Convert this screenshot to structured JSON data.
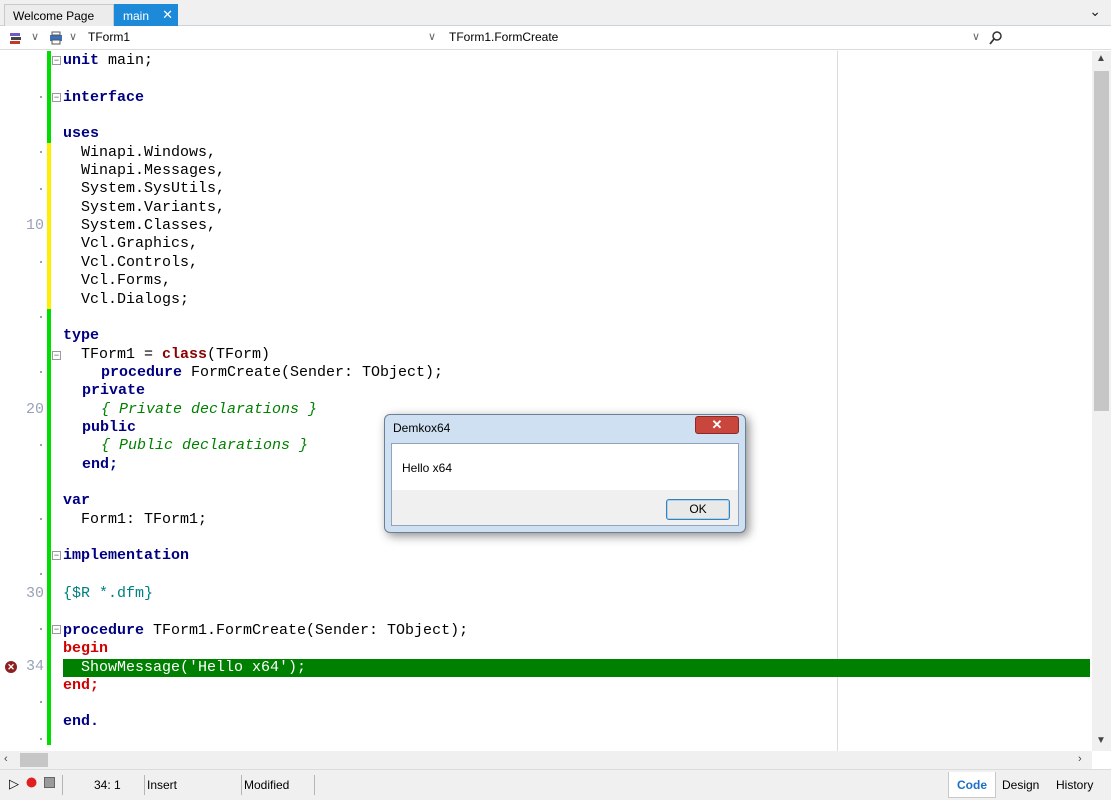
{
  "tabs": {
    "welcome_label": "Welcome Page",
    "main_label": "main",
    "close_glyph": "✕",
    "overflow_glyph": "⌄"
  },
  "toolbar": {
    "class_combo_value": "TForm1",
    "method_combo_value": "TForm1.FormCreate"
  },
  "editor": {
    "line_numbers": [
      "10",
      "20",
      "30",
      "34"
    ],
    "lines": {
      "l1": "unit main;",
      "l3": "interface",
      "l5": "uses",
      "l6": "  Winapi.Windows,",
      "l7": "  Winapi.Messages,",
      "l8": "  System.SysUtils,",
      "l9": "  System.Variants,",
      "l10": "  System.Classes,",
      "l11": "  Vcl.Graphics,",
      "l12": "  Vcl.Controls,",
      "l13": "  Vcl.Forms,",
      "l14": "  Vcl.Dialogs;",
      "l16": "type",
      "l17a": "  TForm1 = ",
      "l17b": "class",
      "l17c": "(TForm)",
      "l18a": "procedure",
      "l18b": " FormCreate(Sender: TObject);",
      "l19": "private",
      "l20": "{ Private declarations }",
      "l21": "public",
      "l22": "{ Public declarations }",
      "l23": "end;",
      "l25": "var",
      "l26": "  Form1: TForm1;",
      "l28": "implementation",
      "l30": "{$R *.dfm}",
      "l32a": "procedure",
      "l32b": " TForm1.FormCreate(Sender: TObject);",
      "l33": "begin",
      "l34": "  ShowMessage('Hello x64');",
      "l35": "end;",
      "l37": "end."
    }
  },
  "status": {
    "position": "34:  1",
    "mode": "Insert",
    "state": "Modified",
    "views": [
      "Code",
      "Design",
      "History"
    ]
  },
  "dialog": {
    "title": "Demkox64",
    "close_glyph": "✕",
    "message": "Hello x64",
    "ok_label": "OK"
  },
  "colors": {
    "execution_line": "#008000",
    "tab_active": "#1c8ad8",
    "change_saved": "#00dd00",
    "change_unsaved": "#ffee00"
  }
}
